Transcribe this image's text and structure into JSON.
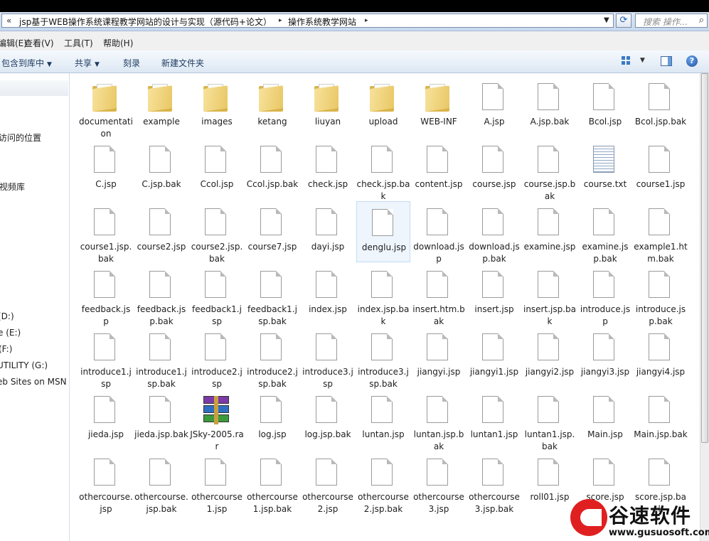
{
  "address_bar": {
    "chevron": "«",
    "crumbs": [
      "jsp基于WEB操作系统课程教学网站的设计与实现（源代码+论文）",
      "操作系统教学网站"
    ],
    "separator": "▸"
  },
  "search": {
    "placeholder": "搜索 操作..."
  },
  "menubar": {
    "items": [
      "编辑(E)",
      "查看(V)",
      "工具(T)",
      "帮助(H)"
    ]
  },
  "toolbar": {
    "items": [
      "包含到库中",
      "共享",
      "刻录",
      "新建文件夹"
    ]
  },
  "nav": {
    "items": [
      "访问的位置",
      "视频库",
      "(D:)",
      "e (E:)",
      "(F:)",
      "UTILITY (G:)",
      "eb Sites on MSN"
    ]
  },
  "files": [
    {
      "name": "documentation",
      "type": "folder"
    },
    {
      "name": "example",
      "type": "folder"
    },
    {
      "name": "images",
      "type": "folder"
    },
    {
      "name": "ketang",
      "type": "folder"
    },
    {
      "name": "liuyan",
      "type": "folder"
    },
    {
      "name": "upload",
      "type": "folder"
    },
    {
      "name": "WEB-INF",
      "type": "folder"
    },
    {
      "name": "A.jsp",
      "type": "file"
    },
    {
      "name": "A.jsp.bak",
      "type": "file"
    },
    {
      "name": "Bcol.jsp",
      "type": "file"
    },
    {
      "name": "Bcol.jsp.bak",
      "type": "file"
    },
    {
      "name": "C.jsp",
      "type": "file"
    },
    {
      "name": "C.jsp.bak",
      "type": "file"
    },
    {
      "name": "Ccol.jsp",
      "type": "file"
    },
    {
      "name": "Ccol.jsp.bak",
      "type": "file"
    },
    {
      "name": "check.jsp",
      "type": "file"
    },
    {
      "name": "check.jsp.bak",
      "type": "file"
    },
    {
      "name": "content.jsp",
      "type": "file"
    },
    {
      "name": "course.jsp",
      "type": "file"
    },
    {
      "name": "course.jsp.bak",
      "type": "file"
    },
    {
      "name": "course.txt",
      "type": "text"
    },
    {
      "name": "course1.jsp",
      "type": "file"
    },
    {
      "name": "course1.jsp.bak",
      "type": "file"
    },
    {
      "name": "course2.jsp",
      "type": "file"
    },
    {
      "name": "course2.jsp.bak",
      "type": "file"
    },
    {
      "name": "course7.jsp",
      "type": "file"
    },
    {
      "name": "dayi.jsp",
      "type": "file"
    },
    {
      "name": "denglu.jsp",
      "type": "file",
      "selected": true
    },
    {
      "name": "download.jsp",
      "type": "file"
    },
    {
      "name": "download.jsp.bak",
      "type": "file"
    },
    {
      "name": "examine.jsp",
      "type": "file"
    },
    {
      "name": "examine.jsp.bak",
      "type": "file"
    },
    {
      "name": "example1.htm.bak",
      "type": "file"
    },
    {
      "name": "feedback.jsp",
      "type": "file"
    },
    {
      "name": "feedback.jsp.bak",
      "type": "file"
    },
    {
      "name": "feedback1.jsp",
      "type": "file"
    },
    {
      "name": "feedback1.jsp.bak",
      "type": "file"
    },
    {
      "name": "index.jsp",
      "type": "file"
    },
    {
      "name": "index.jsp.bak",
      "type": "file"
    },
    {
      "name": "insert.htm.bak",
      "type": "file"
    },
    {
      "name": "insert.jsp",
      "type": "file"
    },
    {
      "name": "insert.jsp.bak",
      "type": "file"
    },
    {
      "name": "introduce.jsp",
      "type": "file"
    },
    {
      "name": "introduce.jsp.bak",
      "type": "file"
    },
    {
      "name": "introduce1.jsp",
      "type": "file"
    },
    {
      "name": "introduce1.jsp.bak",
      "type": "file"
    },
    {
      "name": "introduce2.jsp",
      "type": "file"
    },
    {
      "name": "introduce2.jsp.bak",
      "type": "file"
    },
    {
      "name": "introduce3.jsp",
      "type": "file"
    },
    {
      "name": "introduce3.jsp.bak",
      "type": "file"
    },
    {
      "name": "jiangyi.jsp",
      "type": "file"
    },
    {
      "name": "jiangyi1.jsp",
      "type": "file"
    },
    {
      "name": "jiangyi2.jsp",
      "type": "file"
    },
    {
      "name": "jiangyi3.jsp",
      "type": "file"
    },
    {
      "name": "jiangyi4.jsp",
      "type": "file"
    },
    {
      "name": "jieda.jsp",
      "type": "file"
    },
    {
      "name": "jieda.jsp.bak",
      "type": "file"
    },
    {
      "name": "JSky-2005.rar",
      "type": "rar"
    },
    {
      "name": "log.jsp",
      "type": "file"
    },
    {
      "name": "log.jsp.bak",
      "type": "file"
    },
    {
      "name": "luntan.jsp",
      "type": "file"
    },
    {
      "name": "luntan.jsp.bak",
      "type": "file"
    },
    {
      "name": "luntan1.jsp",
      "type": "file"
    },
    {
      "name": "luntan1.jsp.bak",
      "type": "file"
    },
    {
      "name": "Main.jsp",
      "type": "file"
    },
    {
      "name": "Main.jsp.bak",
      "type": "file"
    },
    {
      "name": "othercourse.jsp",
      "type": "file"
    },
    {
      "name": "othercourse.jsp.bak",
      "type": "file"
    },
    {
      "name": "othercourse1.jsp",
      "type": "file"
    },
    {
      "name": "othercourse1.jsp.bak",
      "type": "file"
    },
    {
      "name": "othercourse2.jsp",
      "type": "file"
    },
    {
      "name": "othercourse2.jsp.bak",
      "type": "file"
    },
    {
      "name": "othercourse3.jsp",
      "type": "file"
    },
    {
      "name": "othercourse3.jsp.bak",
      "type": "file"
    },
    {
      "name": "roll01.jsp",
      "type": "file"
    },
    {
      "name": "score.jsp",
      "type": "file"
    },
    {
      "name": "score.jsp.bak",
      "type": "file"
    }
  ],
  "watermark": {
    "title": "谷速软件",
    "url": "www.gusuosoft.com"
  },
  "colors": {
    "selection": "#eef5fd",
    "folder": "#e9c765",
    "accent": "#1e3a5f"
  }
}
